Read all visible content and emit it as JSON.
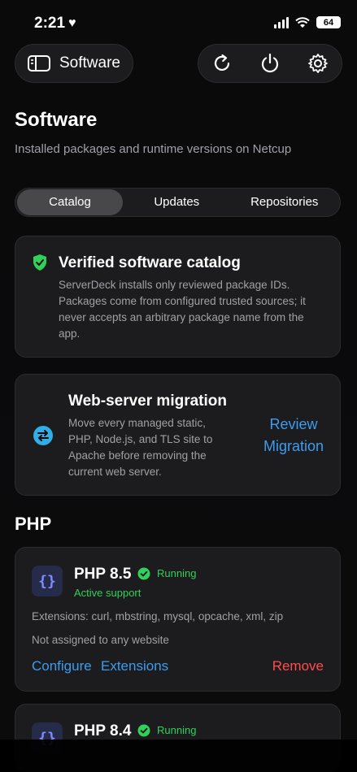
{
  "status": {
    "time": "2:21",
    "battery": "64"
  },
  "header": {
    "title": "Software",
    "actions": [
      "refresh-icon",
      "power-icon",
      "gear-icon"
    ]
  },
  "page": {
    "title": "Software",
    "subtitle": "Installed packages and runtime versions on Netcup"
  },
  "tabs": [
    {
      "label": "Catalog",
      "active": true
    },
    {
      "label": "Updates",
      "active": false
    },
    {
      "label": "Repositories",
      "active": false
    }
  ],
  "catalog_card": {
    "title": "Verified software catalog",
    "lines": [
      "ServerDeck installs only reviewed package IDs.",
      "Packages come from configured trusted sources; it",
      "never accepts an arbitrary package name from the",
      "app."
    ]
  },
  "migration_card": {
    "title": "Web-server migration",
    "lines": [
      "Move every managed static,",
      "PHP, Node.js, and TLS site to",
      "Apache before removing the",
      "current web server."
    ],
    "action_line1": "Review",
    "action_line2": "Migration"
  },
  "php_section": {
    "title": "PHP"
  },
  "php_items": [
    {
      "name": "PHP 8.5",
      "status": "Running",
      "support": "Active support",
      "extensions": "Extensions: curl, mbstring, mysql, opcache, xml, zip",
      "assignment": "Not assigned to any website",
      "configure": "Configure",
      "extensions_link": "Extensions",
      "remove": "Remove"
    },
    {
      "name": "PHP 8.4",
      "status": "Running"
    }
  ],
  "colors": {
    "accent": "#3b9cf0",
    "danger": "#ff4d4f",
    "success": "#30d158",
    "card": "#1c1c1e"
  }
}
